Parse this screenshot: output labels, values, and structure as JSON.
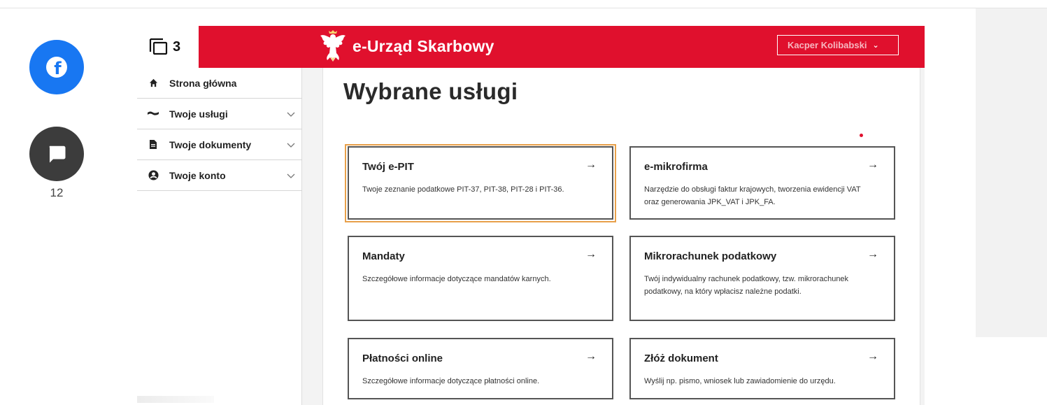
{
  "share": {
    "facebook_icon": "facebook-icon",
    "comment_icon": "comment-icon",
    "comment_count": "12"
  },
  "gallery": {
    "icon": "gallery-icon",
    "count": "3"
  },
  "header": {
    "logo_icon": "polish-eagle-icon",
    "app_title": "e-Urząd Skarbowy",
    "user_name": "Kacper Kolibabski",
    "brand_color": "#e0102d"
  },
  "sidebar": {
    "items": [
      {
        "label": "Strona główna",
        "icon": "home-icon",
        "has_dropdown": false
      },
      {
        "label": "Twoje usługi",
        "icon": "services-icon",
        "has_dropdown": true
      },
      {
        "label": "Twoje dokumenty",
        "icon": "document-icon",
        "has_dropdown": true
      },
      {
        "label": "Twoje konto",
        "icon": "user-icon",
        "has_dropdown": true
      }
    ]
  },
  "main": {
    "page_title": "Wybrane usługi",
    "tiles": [
      {
        "title": "Twój e-PIT",
        "description": "Twoje zeznanie podatkowe PIT-37, PIT-38, PIT-28 i PIT-36.",
        "arrow": "→"
      },
      {
        "title": "e-mikrofirma",
        "description": "Narzędzie do obsługi faktur krajowych, tworzenia ewidencji VAT oraz generowania JPK_VAT i JPK_FA.",
        "arrow": "→"
      },
      {
        "title": "Mandaty",
        "description": "Szczegółowe informacje dotyczące mandatów karnych.",
        "arrow": "→"
      },
      {
        "title": "Mikrorachunek podatkowy",
        "description": "Twój indywidualny rachunek podatkowy, tzw. mikrorachunek podatkowy, na który wpłacisz należne podatki.",
        "arrow": "→"
      },
      {
        "title": "Płatności online",
        "description": "Szczegółowe informacje dotyczące płatności online.",
        "arrow": "→"
      },
      {
        "title": "Złóż dokument",
        "description": "Wyślij np. pismo, wniosek lub zawiadomienie do urzędu.",
        "arrow": "→"
      }
    ]
  }
}
